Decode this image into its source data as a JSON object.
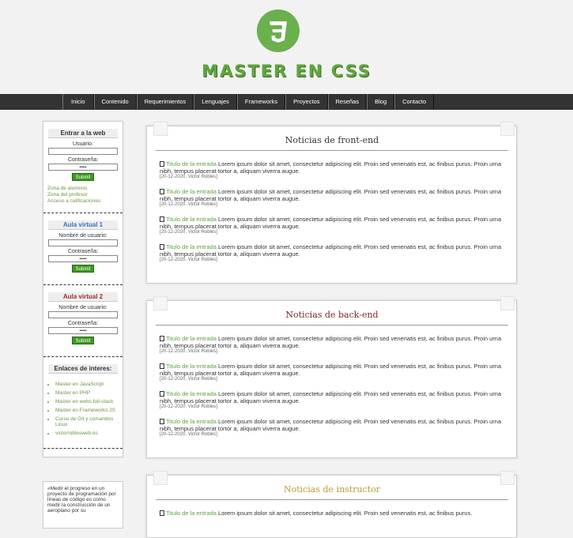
{
  "header": {
    "site_title": "MASTER EN CSS",
    "logo_icon": "css3-logo-icon",
    "logo_color": "#6ab04c"
  },
  "nav": {
    "items": [
      "Inicio",
      "Contenido",
      "Requerimientos",
      "Lenguajes",
      "Frameworks",
      "Proyectos",
      "Reseñas",
      "Blog",
      "Contacto"
    ]
  },
  "sidebar": {
    "login": {
      "title": "Entrar a la web",
      "user_label": "Usuario:",
      "pass_label": "Contraseña:",
      "pass_value": "•••••",
      "submit": "Submit",
      "links": [
        "Zona de alumnos",
        "Zona del profesor",
        "Acceso a calificaciones"
      ]
    },
    "aula1": {
      "title": "Aula virtual 1",
      "user_label": "Nombre de usuario:",
      "pass_label": "Contraseña:",
      "pass_value": "•••••",
      "submit": "Submit"
    },
    "aula2": {
      "title": "Aula virtual 2",
      "user_label": "Nombre de usuario:",
      "pass_label": "Contraseña:",
      "pass_value": "•••••",
      "submit": "Submit"
    },
    "interest": {
      "title": "Enlaces de interes:",
      "links": [
        "Master en JavaScript",
        "Master en PHP",
        "Master en webs full-stack",
        "Master en Frameworks JS",
        "Curso de Git y comandos Linux",
        "victorroblesweb.es"
      ]
    },
    "quote": "«Medir el progreso en un proyecto de programación por líneas de código es como medir la construcción de un aeroplano por su"
  },
  "sections": [
    {
      "title": "Noticias de front-end",
      "articles": [
        {
          "title": "Titulo de la entrada",
          "text": "Lorem ipsum dolor sit amet, consectetur adipiscing elit. Proin sed venenatis est, ac finibus purus. Proin urna nibh, tempus placerat tortor a, aliquam viverra augue.",
          "meta": "[20-12-2020, Victor Robles]"
        },
        {
          "title": "Titulo de la entrada",
          "text": "Lorem ipsum dolor sit amet, consectetur adipiscing elit. Proin sed venenatis est, ac finibus purus. Proin urna nibh, tempus placerat tortor a, aliquam viverra augue.",
          "meta": "[20-12-2020, Victor Robles]"
        },
        {
          "title": "Titulo de la entrada",
          "text": "Lorem ipsum dolor sit amet, consectetur adipiscing elit. Proin sed venenatis est, ac finibus purus. Proin urna nibh, tempus placerat tortor a, aliquam viverra augue.",
          "meta": "[20-12-2020, Victor Robles]"
        },
        {
          "title": "Titulo de la entrada",
          "text": "Lorem ipsum dolor sit amet, consectetur adipiscing elit. Proin sed venenatis est, ac finibus purus. Proin urna nibh, tempus placerat tortor a, aliquam viverra augue.",
          "meta": "[20-12-2020, Victor Robles]"
        }
      ]
    },
    {
      "title": "Noticias de back-end",
      "articles": [
        {
          "title": "Titulo de la entrada",
          "text": "Lorem ipsum dolor sit amet, consectetur adipiscing elit. Proin sed venenatis est, ac finibus purus. Proin urna nibh, tempus placerat tortor a, aliquam viverra augue.",
          "meta": "[20-12-2020, Victor Robles]"
        },
        {
          "title": "Titulo de la entrada",
          "text": "Lorem ipsum dolor sit amet, consectetur adipiscing elit. Proin sed venenatis est, ac finibus purus. Proin urna nibh, tempus placerat tortor a, aliquam viverra augue.",
          "meta": "[20-12-2020, Victor Robles]"
        },
        {
          "title": "Titulo de la entrada",
          "text": "Lorem ipsum dolor sit amet, consectetur adipiscing elit. Proin sed venenatis est, ac finibus purus. Proin urna nibh, tempus placerat tortor a, aliquam viverra augue.",
          "meta": "[20-12-2020, Victor Robles]"
        },
        {
          "title": "Titulo de la entrada",
          "text": "Lorem ipsum dolor sit amet, consectetur adipiscing elit. Proin sed venenatis est, ac finibus purus. Proin urna nibh, tempus placerat tortor a, aliquam viverra augue.",
          "meta": "[20-12-2020, Victor Robles]"
        }
      ]
    },
    {
      "title": "Noticias de instructor",
      "articles": [
        {
          "title": "Titulo de la entrada",
          "text": "Lorem ipsum dolor sit amet, consectetur adipiscing elit. Proin sed venenatis est, ac finibus purus.",
          "meta": ""
        }
      ]
    }
  ]
}
